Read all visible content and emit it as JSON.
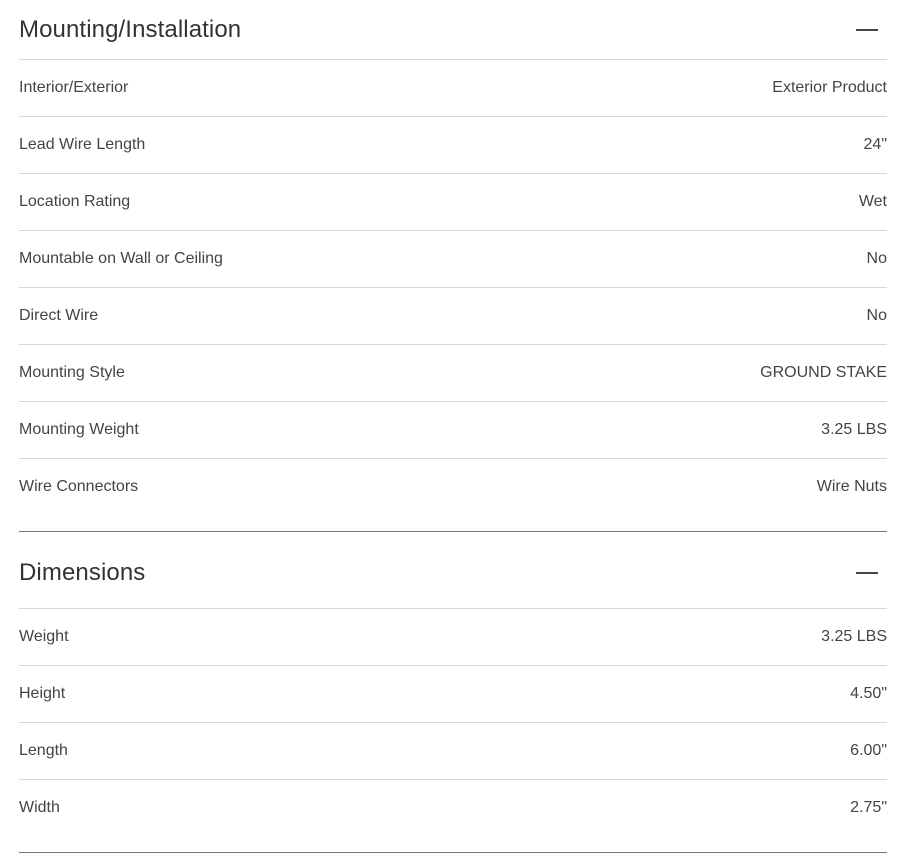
{
  "sections": [
    {
      "title": "Mounting/Installation",
      "toggle_icon": "minus-icon",
      "rows": [
        {
          "label": "Interior/Exterior",
          "value": "Exterior Product"
        },
        {
          "label": "Lead Wire Length",
          "value": "24\""
        },
        {
          "label": "Location Rating",
          "value": "Wet"
        },
        {
          "label": "Mountable on Wall or Ceiling",
          "value": "No"
        },
        {
          "label": "Direct Wire",
          "value": "No"
        },
        {
          "label": "Mounting Style",
          "value": "GROUND STAKE"
        },
        {
          "label": "Mounting Weight",
          "value": "3.25 LBS"
        },
        {
          "label": "Wire Connectors",
          "value": "Wire Nuts"
        }
      ]
    },
    {
      "title": "Dimensions",
      "toggle_icon": "minus-icon",
      "rows": [
        {
          "label": "Weight",
          "value": "3.25 LBS"
        },
        {
          "label": "Height",
          "value": "4.50\""
        },
        {
          "label": "Length",
          "value": "6.00\""
        },
        {
          "label": "Width",
          "value": "2.75\""
        }
      ]
    }
  ]
}
